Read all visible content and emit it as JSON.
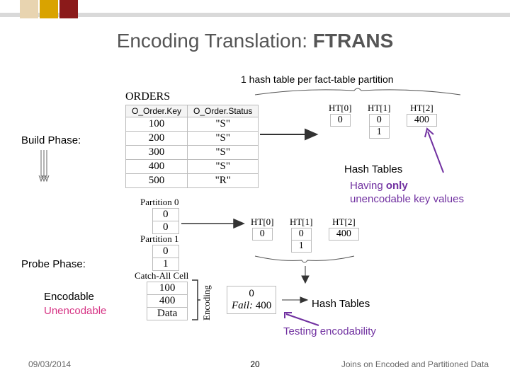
{
  "title_main": "Encoding Translation: ",
  "title_bold": "FTRANS",
  "subtitle": "1 hash table per fact-table partition",
  "orders_label": "ORDERS",
  "orders": {
    "headers": [
      "O_Order.Key",
      "O_Order.Status"
    ],
    "rows": [
      [
        "100",
        "\"S\""
      ],
      [
        "200",
        "\"S\""
      ],
      [
        "300",
        "\"S\""
      ],
      [
        "400",
        "\"S\""
      ],
      [
        "500",
        "\"R\""
      ]
    ]
  },
  "build_phase": "Build Phase:",
  "probe_phase": "Probe Phase:",
  "encodable": "Encodable",
  "unencodable": "Unencodable",
  "partition0_label": "Partition 0",
  "partition0": [
    "0",
    "0"
  ],
  "partition1_label": "Partition 1",
  "partition1": [
    "0",
    "1"
  ],
  "catch_label": "Catch-All Cell",
  "catch": [
    "100",
    "400",
    "Data"
  ],
  "encoding_label": "Encoding",
  "ht1": [
    {
      "name": "HT[0]",
      "cells": [
        "0"
      ]
    },
    {
      "name": "HT[1]",
      "cells": [
        "0",
        "1"
      ]
    },
    {
      "name": "HT[2]",
      "cells": [
        "400"
      ]
    }
  ],
  "ht2": [
    {
      "name": "HT[0]",
      "cells": [
        "0"
      ]
    },
    {
      "name": "HT[1]",
      "cells": [
        "0",
        "1"
      ]
    },
    {
      "name": "HT[2]",
      "cells": [
        "400"
      ]
    }
  ],
  "hash_tables_text": "Hash Tables",
  "having_text_l1": "Having ",
  "having_text_l1b": "only",
  "having_text_l2": "unencodable key values",
  "result_line1": "0",
  "result_fail": "Fail:",
  "result_fail_val": " 400",
  "testing_text": "Testing encodability",
  "footer": {
    "date": "09/03/2014",
    "page": "20",
    "right": "Joins on Encoded and Partitioned Data"
  }
}
